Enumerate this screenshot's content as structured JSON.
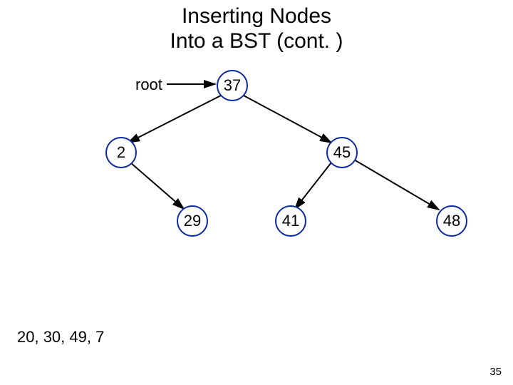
{
  "title_line1": "Inserting Nodes",
  "title_line2": "Into a BST (cont. )",
  "root_label": "root",
  "nodes": {
    "n37": "37",
    "n2": "2",
    "n45": "45",
    "n29": "29",
    "n41": "41",
    "n48": "48"
  },
  "insert_queue": "20, 30, 49, 7",
  "page_number": "35",
  "colors": {
    "node_border": "#0b2aa0",
    "edge": "#000000"
  },
  "chart_data": {
    "type": "tree",
    "title": "Inserting Nodes Into a BST (cont.)",
    "root_pointer_label": "root",
    "nodes": [
      {
        "id": "37",
        "value": 37,
        "children": [
          "2",
          "45"
        ]
      },
      {
        "id": "2",
        "value": 2,
        "children": [
          null,
          "29"
        ]
      },
      {
        "id": "45",
        "value": 45,
        "children": [
          "41",
          "48"
        ]
      },
      {
        "id": "29",
        "value": 29,
        "children": []
      },
      {
        "id": "41",
        "value": 41,
        "children": []
      },
      {
        "id": "48",
        "value": 48,
        "children": []
      }
    ],
    "root": "37",
    "pending_insertions": [
      20,
      30,
      49,
      7
    ]
  }
}
